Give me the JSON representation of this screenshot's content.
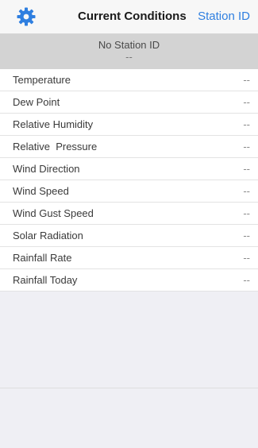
{
  "nav": {
    "settings_icon": "gear-icon",
    "title": "Current Conditions",
    "right_button": "Station ID",
    "accent_color": "#2f7fe0"
  },
  "station": {
    "name": "No Station ID",
    "sub": "--"
  },
  "rows": [
    {
      "label": "Temperature",
      "value": "--"
    },
    {
      "label": "Dew Point",
      "value": "--"
    },
    {
      "label": "Relative Humidity",
      "value": "--"
    },
    {
      "label": "Relative  Pressure",
      "value": "--"
    },
    {
      "label": "Wind Direction",
      "value": "--"
    },
    {
      "label": "Wind Speed",
      "value": "--"
    },
    {
      "label": "Wind Gust Speed",
      "value": "--"
    },
    {
      "label": "Solar Radiation",
      "value": "--"
    },
    {
      "label": "Rainfall Rate",
      "value": "--"
    },
    {
      "label": "Rainfall Today",
      "value": "--"
    }
  ]
}
